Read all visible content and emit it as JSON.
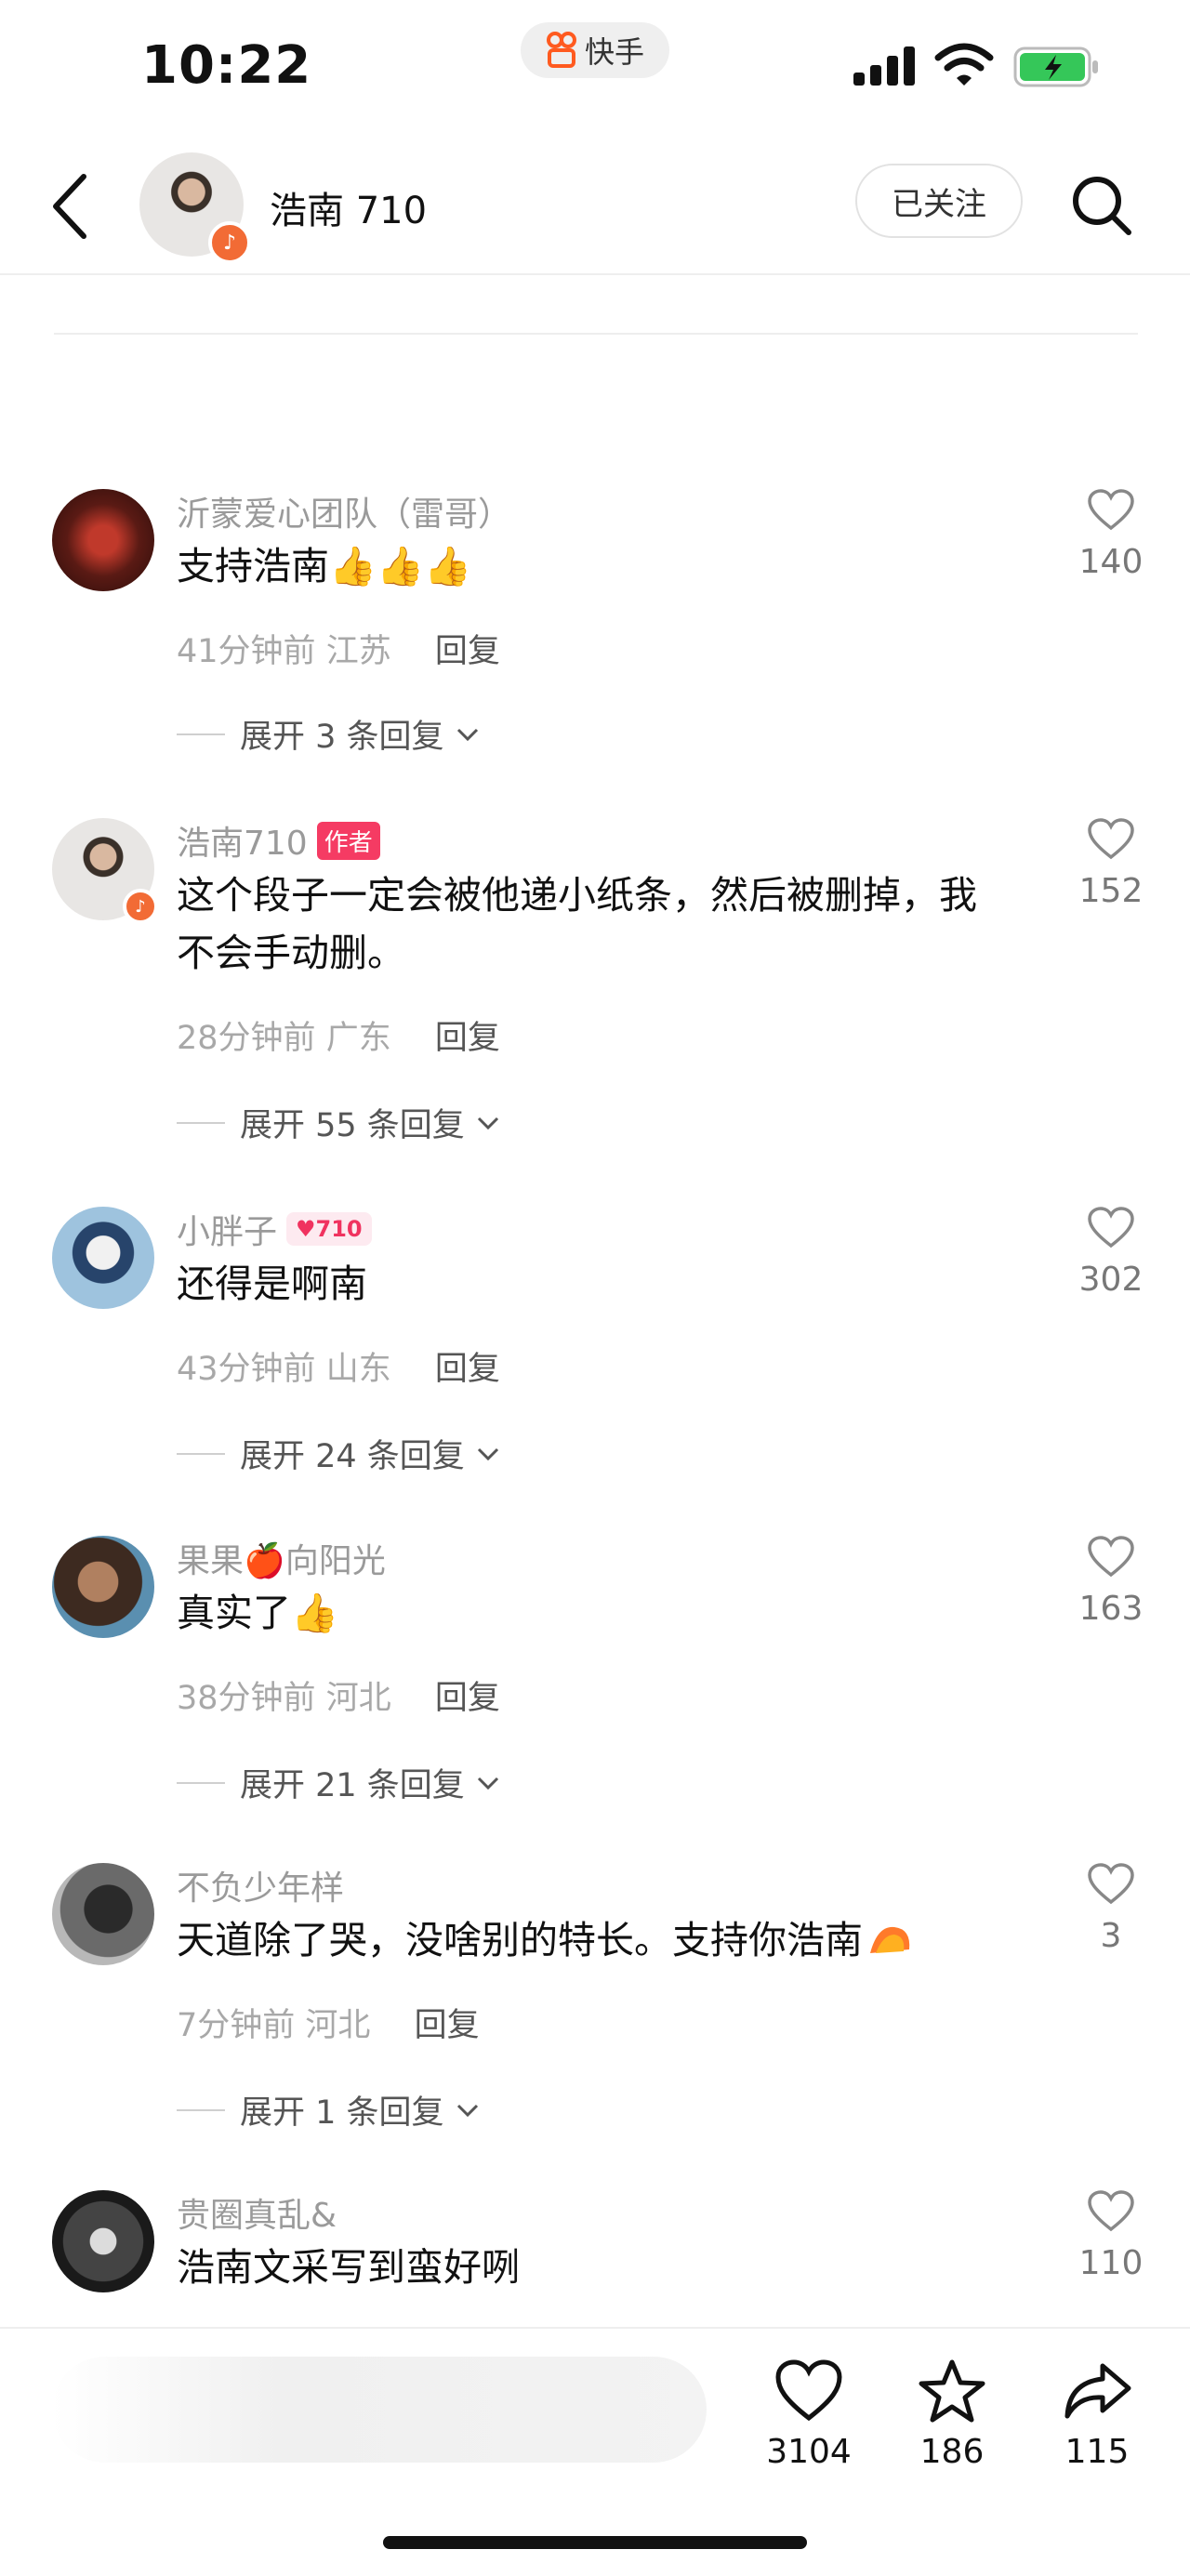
{
  "status_bar": {
    "time": "10:22",
    "app_name": "快手"
  },
  "header": {
    "name": "浩南 710",
    "follow_label": "已关注"
  },
  "comments": [
    {
      "name": "沂蒙爱心团队（雷哥）",
      "text": "支持浩南👍👍👍",
      "time": "41分钟前",
      "location": "江苏",
      "reply": "回复",
      "expand": "展开 3 条回复",
      "likes": "140"
    },
    {
      "name": "浩南710",
      "tag": "作者",
      "text": "这个段子一定会被他递小纸条，然后被删掉，我不会手动删。",
      "time": "28分钟前",
      "location": "广东",
      "reply": "回复",
      "expand": "展开 55 条回复",
      "likes": "152"
    },
    {
      "name": "小胖子",
      "tag": "♥710",
      "text": "还得是啊南",
      "time": "43分钟前",
      "location": "山东",
      "reply": "回复",
      "expand": "展开 24 条回复",
      "likes": "302"
    },
    {
      "name": "果果🍎向阳光",
      "text": "真实了👍",
      "time": "38分钟前",
      "location": "河北",
      "reply": "回复",
      "expand": "展开 21 条回复",
      "likes": "163"
    },
    {
      "name": "不负少年样",
      "text": "天道除了哭，没啥别的特长。支持你浩南",
      "time": "7分钟前",
      "location": "河北",
      "reply": "回复",
      "expand": "展开 1 条回复",
      "likes": "3"
    },
    {
      "name": "贵圈真乱&",
      "text": "浩南文采写到蛮好咧",
      "likes": "110"
    }
  ],
  "bottom_bar": {
    "likes": "3104",
    "favorites": "186",
    "shares": "115"
  },
  "colors": {
    "accent": "#f26b35",
    "author_tag": "#f53b63"
  }
}
